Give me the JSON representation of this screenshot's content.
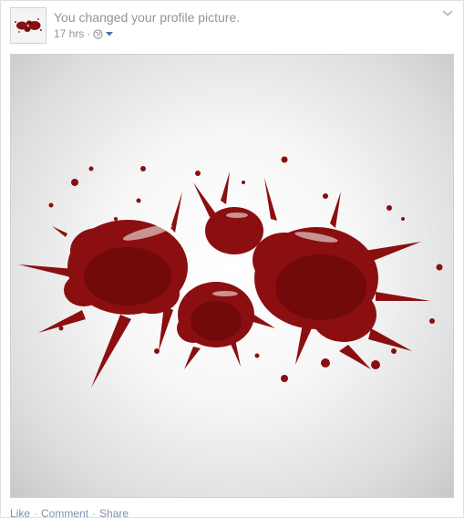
{
  "story": {
    "text": "You changed your profile picture.",
    "timestamp": "17 hrs",
    "separator": "·",
    "audience_icon": "globe-icon",
    "audience_dropdown_icon": "caret-down-icon",
    "menu_icon": "chevron-down-icon"
  },
  "avatar": {
    "icon": "blood-splatter-thumbnail"
  },
  "photo": {
    "subject": "blood-splatter-image",
    "colors": {
      "blood": "#8b0f10",
      "blood_dark": "#6a0708",
      "background": "#f2f2f2"
    }
  },
  "actions": {
    "like": "Like",
    "comment": "Comment",
    "share": "Share",
    "separator": "·"
  },
  "colors": {
    "link": "#7f8fb0",
    "meta_text": "#90949c",
    "card_border": "#dddfe2"
  }
}
